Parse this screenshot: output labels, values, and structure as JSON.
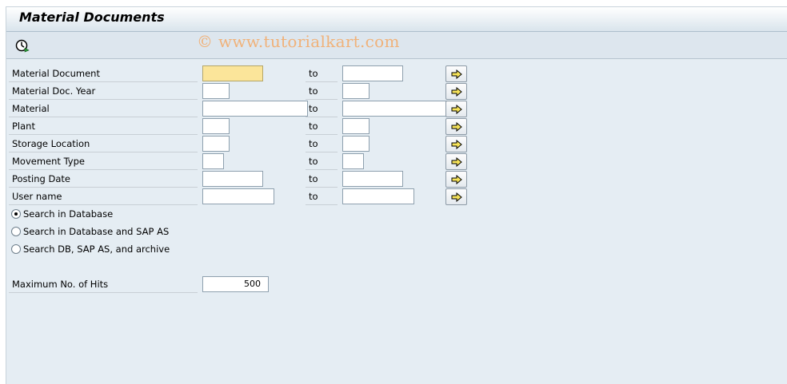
{
  "window": {
    "title": "Material Documents"
  },
  "toolbar": {
    "execute_icon": "execute-clock-icon"
  },
  "watermark": "© www.tutorialkart.com",
  "fields": [
    {
      "label": "Material Document",
      "to": "to",
      "low_value": "",
      "high_value": ""
    },
    {
      "label": "Material Doc. Year",
      "to": "to",
      "low_value": "",
      "high_value": ""
    },
    {
      "label": "Material",
      "to": "to",
      "low_value": "",
      "high_value": ""
    },
    {
      "label": "Plant",
      "to": "to",
      "low_value": "",
      "high_value": ""
    },
    {
      "label": "Storage Location",
      "to": "to",
      "low_value": "",
      "high_value": ""
    },
    {
      "label": "Movement Type",
      "to": "to",
      "low_value": "",
      "high_value": ""
    },
    {
      "label": "Posting Date",
      "to": "to",
      "low_value": "",
      "high_value": ""
    },
    {
      "label": "User name",
      "to": "to",
      "low_value": "",
      "high_value": ""
    }
  ],
  "search_options": [
    {
      "label": "Search in Database",
      "selected": true
    },
    {
      "label": "Search in Database and SAP AS",
      "selected": false
    },
    {
      "label": "Search DB, SAP AS, and archive",
      "selected": false
    }
  ],
  "max_hits": {
    "label": "Maximum No. of Hits",
    "value": "500"
  },
  "colors": {
    "required_field": "#fbe59a",
    "background": "#e5edf3",
    "watermark": "#f0b27a"
  }
}
